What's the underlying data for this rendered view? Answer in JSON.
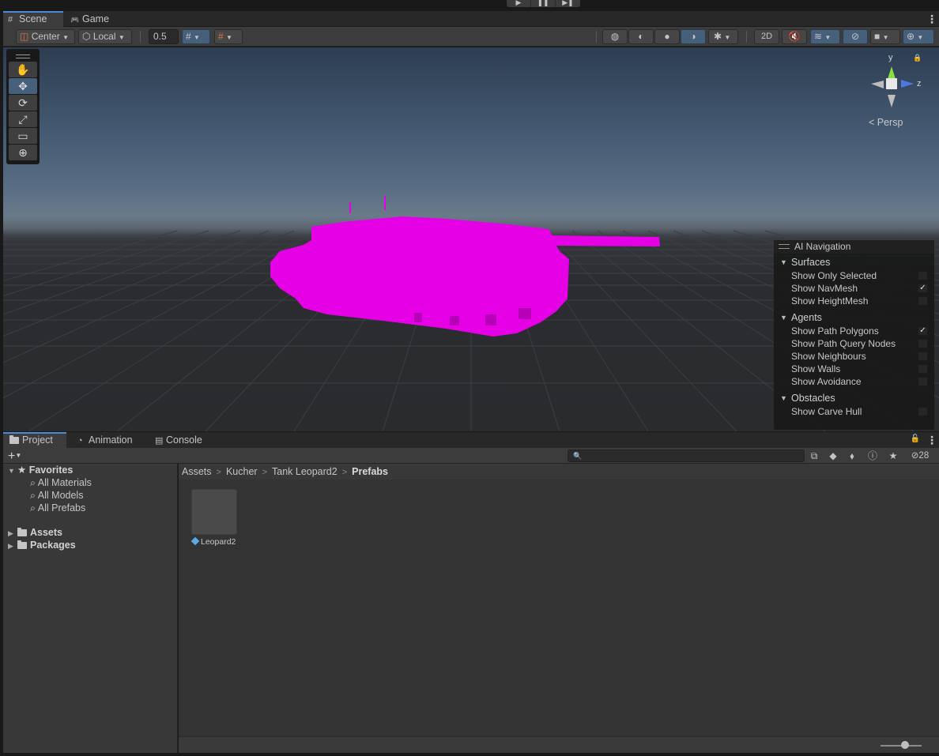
{
  "playbar": {
    "buttons": [
      "▶",
      "❚❚",
      "▶❚"
    ]
  },
  "scene_window": {
    "tabs": [
      {
        "label": "Scene",
        "icon": "#"
      },
      {
        "label": "Game",
        "icon": "🎮"
      }
    ],
    "menu_icon": "⋮"
  },
  "scene_toolbar": {
    "pivot_mode": "Center",
    "pivot_rotation": "Local",
    "grid_snap_value": "0.5",
    "mode_2d": "2D"
  },
  "tools": [
    "✋",
    "✥",
    "⟳",
    "⤢",
    "▭",
    "⊕"
  ],
  "gizmo": {
    "y": "y",
    "z": "z",
    "view": "< Persp"
  },
  "ai_navigation": {
    "title": "AI Navigation",
    "sections": [
      {
        "title": "Surfaces",
        "items": [
          {
            "label": "Show Only Selected",
            "checked": false
          },
          {
            "label": "Show NavMesh",
            "checked": true
          },
          {
            "label": "Show HeightMesh",
            "checked": false
          }
        ]
      },
      {
        "title": "Agents",
        "items": [
          {
            "label": "Show Path Polygons",
            "checked": true
          },
          {
            "label": "Show Path Query Nodes",
            "checked": false
          },
          {
            "label": "Show Neighbours",
            "checked": false
          },
          {
            "label": "Show Walls",
            "checked": false
          },
          {
            "label": "Show Avoidance",
            "checked": false
          }
        ]
      },
      {
        "title": "Obstacles",
        "items": [
          {
            "label": "Show Carve Hull",
            "checked": false
          }
        ]
      }
    ]
  },
  "bottom_panel": {
    "tabs": [
      "Project",
      "Animation",
      "Console"
    ],
    "add_button": "+",
    "hidden_count": "28",
    "favorites": {
      "title": "Favorites",
      "items": [
        "All Materials",
        "All Models",
        "All Prefabs"
      ]
    },
    "roots": [
      "Assets",
      "Packages"
    ],
    "breadcrumb": [
      "Assets",
      "Kucher",
      "Tank Leopard2",
      "Prefabs"
    ],
    "assets": [
      {
        "name": "Leopard2"
      }
    ],
    "thumbnail_size": 0.6
  },
  "colors": {
    "accent": "#4c8ad8",
    "missing_material": "#e600e6",
    "panel_bg": "#383838"
  }
}
